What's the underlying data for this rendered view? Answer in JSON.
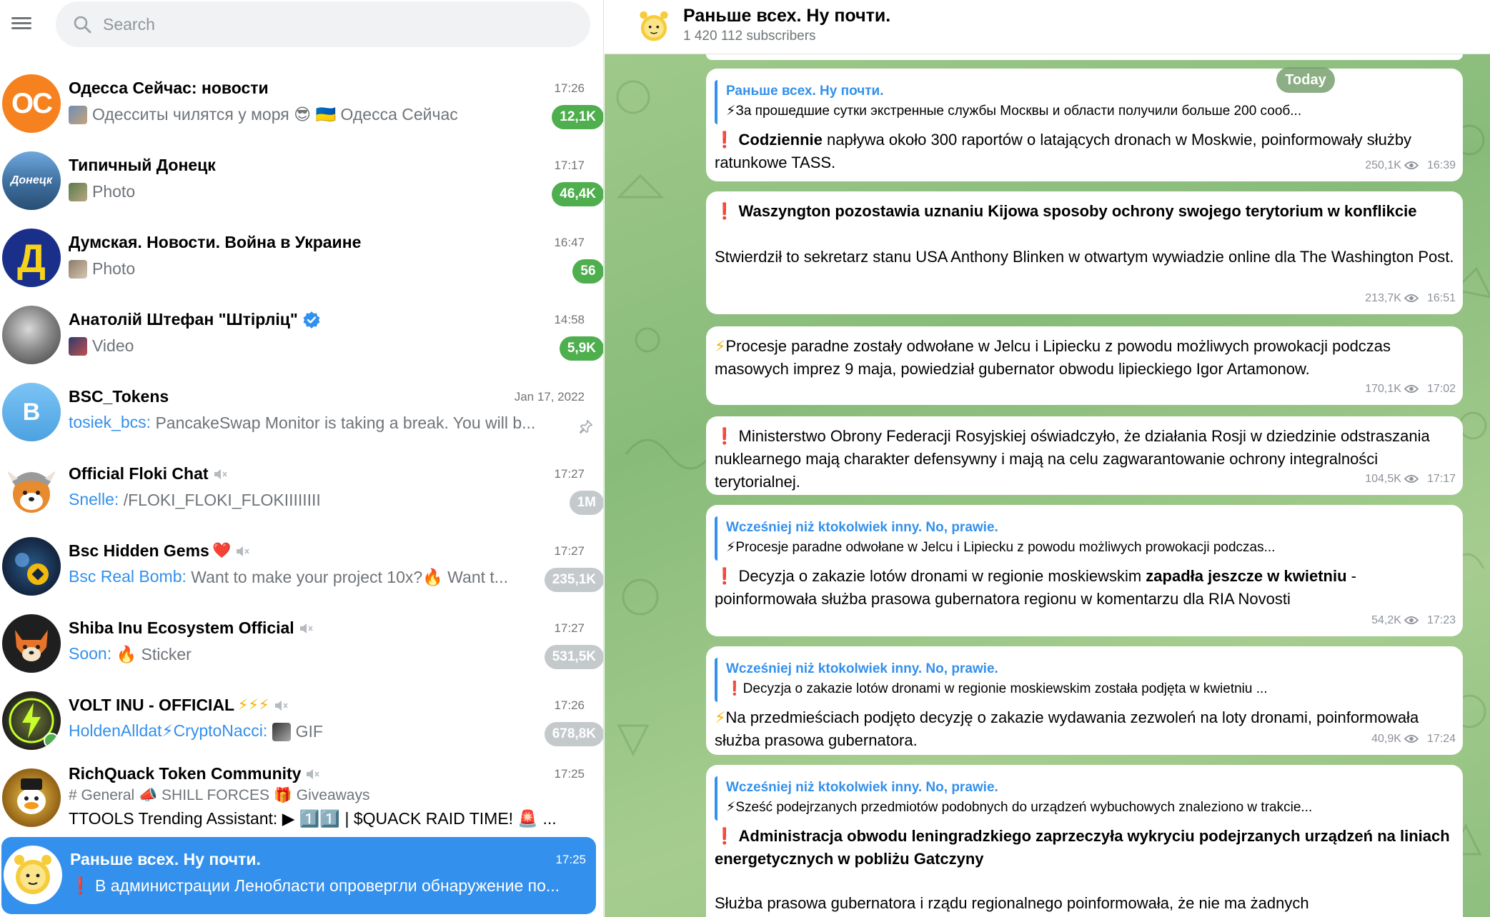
{
  "search": {
    "placeholder": "Search"
  },
  "chats": [
    {
      "title": "Одесса Сейчас: новости",
      "time": "17:26",
      "preview": "Одесситы чилятся у моря 😎 🇺🇦 Одесса Сейчас",
      "badge": "12,1K",
      "avatar_text": "OC"
    },
    {
      "title": "Типичный Донецк",
      "time": "17:17",
      "preview": "Photo",
      "badge": "46,4K",
      "avatar_text": "Донецк"
    },
    {
      "title": "Думская. Новости. Война в Украине",
      "time": "16:47",
      "preview": "Photo",
      "badge": "56",
      "avatar_text": "Д"
    },
    {
      "title": "Анатолій Штефан \"Штірліц\"",
      "time": "14:58",
      "preview": "Video",
      "badge": "5,9K"
    },
    {
      "title": "BSC_Tokens",
      "time": "Jan 17, 2022",
      "sender": "tosiek_bcs:",
      "preview": "PancakeSwap Monitor is taking a break. You will b...",
      "avatar_text": "B"
    },
    {
      "title": "Official Floki Chat",
      "time": "17:27",
      "sender": "Snelle:",
      "preview": "/FLOKI_FLOKI_FLOKIIIIIIII",
      "badge": "1M"
    },
    {
      "title": "Bsc Hidden Gems",
      "title_emoji": "❤️",
      "time": "17:27",
      "sender": "Bsc Real Bomb:",
      "preview": "Want to make your project 10x?🔥 Want t...",
      "badge": "235,1K"
    },
    {
      "title": "Shiba Inu Ecosystem Official",
      "time": "17:27",
      "sender": "Soon:",
      "preview": "🔥 Sticker",
      "badge": "531,5K"
    },
    {
      "title": "VOLT INU - OFFICIAL",
      "title_emoji": "⚡⚡⚡",
      "time": "17:26",
      "sender": "HoldenAlldat⚡CryptoNacci:",
      "preview": "GIF",
      "badge": "678,8K"
    },
    {
      "title": "RichQuack Token Community",
      "time": "17:25",
      "topics": "# General 📣 SHILL FORCES 🎁 Giveaways",
      "preview": "TTOOLS Trending Assistant: ▶ 1️⃣1️⃣ | $QUACK RAID TIME! 🚨 ..."
    },
    {
      "title": "Раньше всех. Ну почти.",
      "time": "17:25",
      "preview": "❗ В администрации Ленобласти опровергли обнаружение по..."
    }
  ],
  "channel": {
    "title": "Раньше всех. Ну почти.",
    "subscribers": "1 420 112 subscribers"
  },
  "today_label": "Today",
  "messages": [
    {
      "quote_title": "Раньше всех. Ну почти.",
      "quote_text": "⚡За прошедшие сутки экстренные службы Москвы и области получили больше 200 сооб...",
      "mark": "❗",
      "bold": "Codziennie",
      "text": " napływa około 300 raportów o latających dronach w Moskwie, poinformowały służby ratunkowe TASS.",
      "views": "250,1K",
      "time": "16:39"
    },
    {
      "mark": "❗",
      "bold": "Waszyngton pozostawia uznaniu Kijowa sposoby ochrony swojego terytorium w konflikcie",
      "text": "Stwierdził to sekretarz stanu USA Anthony Blinken w otwartym wywiadzie online dla The Washington Post.",
      "views": "213,7K",
      "time": "16:51"
    },
    {
      "mark": "⚡",
      "text": "Procesje paradne zostały odwołane w Jelcu i Lipiecku z powodu możliwych prowokacji podczas masowych imprez 9 maja, powiedział gubernator obwodu lipieckiego Igor Artamonow.",
      "views": "170,1K",
      "time": "17:02"
    },
    {
      "mark": "❗",
      "text": "Ministerstwo Obrony Federacji Rosyjskiej oświadczyło, że działania Rosji w dziedzinie odstraszania nuklearnego mają charakter defensywny i mają na celu zagwarantowanie ochrony integralności terytorialnej.",
      "views": "104,5K",
      "time": "17:17"
    },
    {
      "quote_title": "Wcześniej niż ktokolwiek inny. No, prawie.",
      "quote_text": "⚡Procesje paradne odwołane w Jelcu i Lipiecku z powodu możliwych prowokacji podczas...",
      "mark": "❗",
      "text_a": "Decyzja o zakazie lotów dronami w regionie moskiewskim ",
      "bold": "zapadła jeszcze w kwietniu",
      "text_b": " - poinformowała służba prasowa gubernatora regionu w komentarzu dla RIA Novosti",
      "views": "54,2K",
      "time": "17:23"
    },
    {
      "quote_title": "Wcześniej niż ktokolwiek inny. No, prawie.",
      "quote_text": "❗Decyzja o zakazie lotów dronami w regionie moskiewskim została podjęta w kwietniu ...",
      "mark": "⚡",
      "text": "Na przedmieściach podjęto decyzję o zakazie wydawania zezwoleń na loty dronami, poinformowała służba prasowa gubernatora.",
      "views": "40,9K",
      "time": "17:24"
    },
    {
      "quote_title": "Wcześniej niż ktokolwiek inny. No, prawie.",
      "quote_text": "⚡Sześć podejrzanych przedmiotów podobnych do urządzeń wybuchowych znaleziono w trakcie...",
      "mark": "❗",
      "bold": "Administracja obwodu leningradzkiego zaprzeczyła wykryciu podejrzanych urządzeń na liniach energetycznych w pobliżu Gatczyny",
      "text": "Służba prasowa gubernatora i rządu regionalnego poinformowała, że nie ma żadnych"
    }
  ],
  "colors": {
    "accent": "#3390ec",
    "badge_unmuted": "#4fae4e",
    "badge_muted": "#c4c9cc",
    "chat_bg": "#8fc07f"
  }
}
